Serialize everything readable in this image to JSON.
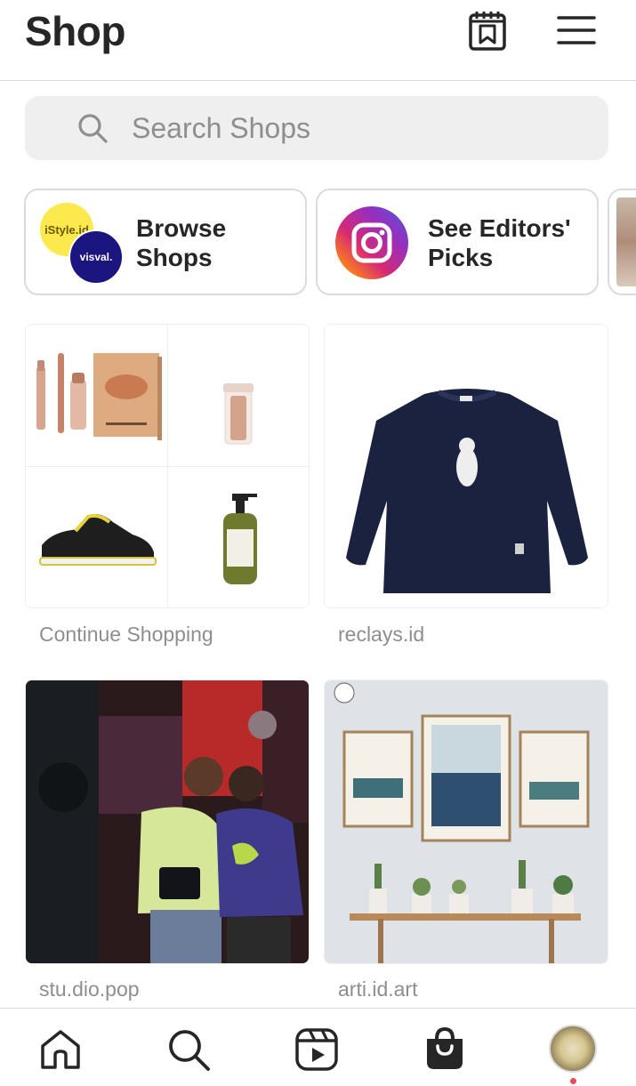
{
  "header": {
    "title": "Shop",
    "wishlist_icon": "wishlist-bookmark-icon",
    "menu_icon": "hamburger-menu-icon"
  },
  "search": {
    "placeholder": "Search Shops",
    "icon": "search-icon"
  },
  "chips": [
    {
      "label_line1": "Browse",
      "label_line2": "Shops",
      "logos": [
        "iStyle.id",
        "visval."
      ]
    },
    {
      "label_line1": "See Editors'",
      "label_line2": "Picks",
      "icon": "instagram-logo"
    }
  ],
  "grid": [
    {
      "label": "Continue Shopping"
    },
    {
      "label": "reclays.id"
    },
    {
      "label": "stu.dio.pop"
    },
    {
      "label": "arti.id.art"
    }
  ],
  "bottom_nav": {
    "items": [
      "home-icon",
      "search-icon",
      "reels-icon",
      "shop-bag-icon",
      "profile-avatar"
    ],
    "active": "shop-bag-icon",
    "notification_dot_color": "#ed4956"
  },
  "colors": {
    "text_primary": "#262626",
    "text_secondary": "#8e8e8e",
    "divider": "#dbdbdb",
    "search_bg": "#efefef"
  }
}
